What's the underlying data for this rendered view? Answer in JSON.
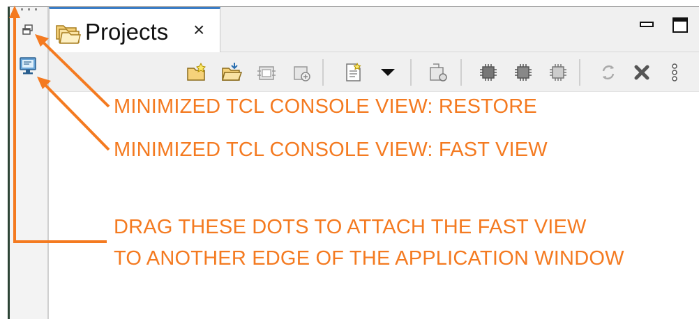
{
  "tab": {
    "label": "Projects",
    "close_glyph": "×",
    "icon": "folders-icon"
  },
  "window_controls": {
    "minimize_icon": "minimize-icon",
    "maximize_icon": "maximize-icon"
  },
  "trim": {
    "restore_icon": "restore-icon",
    "fastview_icon": "tcl-console-icon",
    "drag_handle": "drag-dots"
  },
  "toolbar": {
    "items": [
      "new-project-icon",
      "open-project-icon",
      "import-project-icon",
      "export-project-icon",
      "new-file-icon",
      "view-menu-dropdown",
      "build-icon",
      "chip-icon-1",
      "chip-icon-2",
      "chip-icon-3",
      "sync-icon",
      "delete-icon",
      "more-icon"
    ]
  },
  "annotations": {
    "restore": "MINIMIZED TCL CONSOLE VIEW: RESTORE",
    "fastview": "MINIMIZED TCL CONSOLE VIEW: FAST VIEW",
    "drag_line1": "DRAG THESE DOTS TO ATTACH THE FAST VIEW",
    "drag_line2": "TO ANOTHER EDGE OF THE APPLICATION WINDOW"
  },
  "colors": {
    "annotation": "#f47a20",
    "tab_accent": "#3a7dc6"
  }
}
